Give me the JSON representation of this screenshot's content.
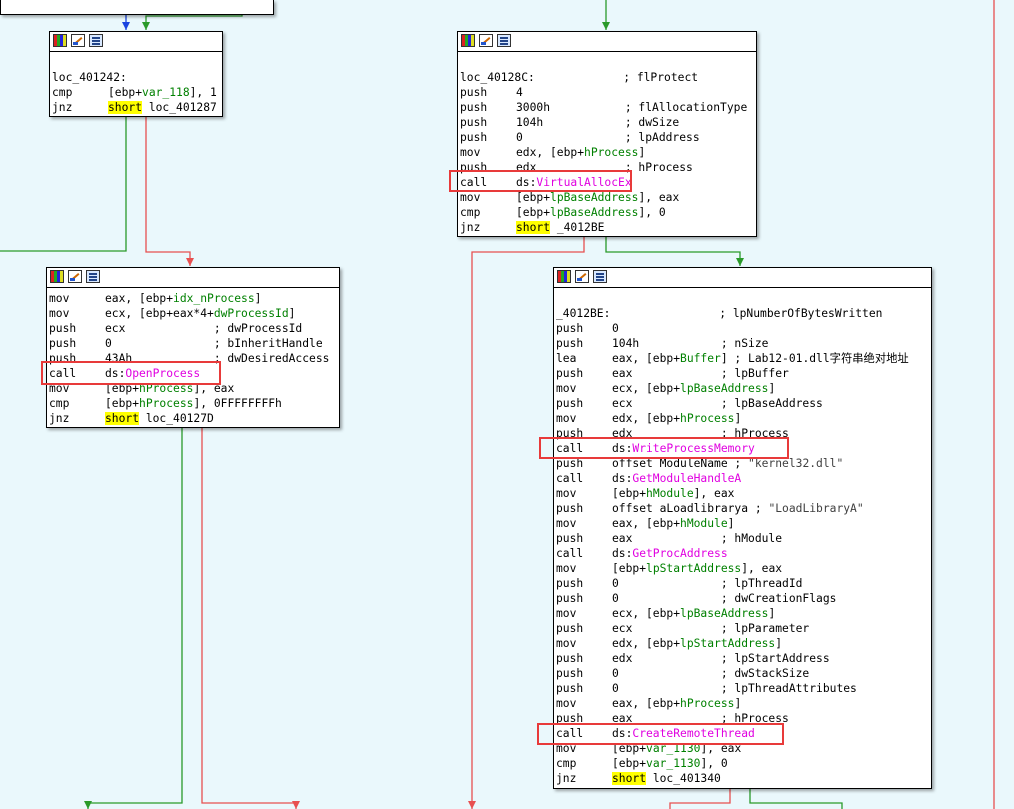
{
  "colors": {
    "bg": "#eaf8fc",
    "green_edge": "#2a9a2a",
    "red_edge": "#e85050",
    "blue_edge": "#1a44e0",
    "func": "#e000e0",
    "var": "#008000",
    "highlight": "#ffff00",
    "callout": "#e83a3a"
  },
  "icons": [
    "palette-icon",
    "edit-graph-icon",
    "listing-icon"
  ],
  "node1": {
    "lines": [
      {
        "label": "",
        "m": "",
        "o": []
      },
      {
        "label": "loc_401242:",
        "m": "",
        "o": []
      },
      {
        "m": "cmp",
        "o": [
          {
            "t": "[ebp+"
          },
          {
            "t": "var_118",
            "c": "v"
          },
          {
            "t": "], 1"
          }
        ]
      },
      {
        "m": "jnz",
        "o": [
          {
            "t": "short",
            "c": "hl"
          },
          {
            "t": " loc_401287"
          }
        ]
      }
    ]
  },
  "node2": {
    "lines": [
      {
        "m": "mov",
        "o": [
          {
            "t": "eax, [ebp+"
          },
          {
            "t": "idx_nProcess",
            "c": "v"
          },
          {
            "t": "]"
          }
        ]
      },
      {
        "m": "mov",
        "o": [
          {
            "t": "ecx, [ebp+eax*4+"
          },
          {
            "t": "dwProcessId",
            "c": "v"
          },
          {
            "t": "]"
          }
        ]
      },
      {
        "m": "push",
        "o": [
          {
            "t": "ecx             ; dwProcessId"
          }
        ]
      },
      {
        "m": "push",
        "o": [
          {
            "t": "0               ; bInheritHandle"
          }
        ]
      },
      {
        "m": "push",
        "o": [
          {
            "t": "43Ah            ; dwDesiredAccess"
          }
        ]
      },
      {
        "m": "call",
        "o": [
          {
            "t": "ds:"
          },
          {
            "t": "OpenProcess",
            "c": "f"
          }
        ]
      },
      {
        "m": "mov",
        "o": [
          {
            "t": "[ebp+"
          },
          {
            "t": "hProcess",
            "c": "v"
          },
          {
            "t": "], eax"
          }
        ]
      },
      {
        "m": "cmp",
        "o": [
          {
            "t": "[ebp+"
          },
          {
            "t": "hProcess",
            "c": "v"
          },
          {
            "t": "], 0FFFFFFFFh"
          }
        ]
      },
      {
        "m": "jnz",
        "o": [
          {
            "t": "short",
            "c": "hl"
          },
          {
            "t": " loc_40127D"
          }
        ]
      }
    ]
  },
  "node3": {
    "lines": [
      {
        "label": "",
        "m": "",
        "o": []
      },
      {
        "label": "loc_40128C:             ; flProtect",
        "m": "",
        "o": []
      },
      {
        "m": "push",
        "o": [
          {
            "t": "4"
          }
        ]
      },
      {
        "m": "push",
        "o": [
          {
            "t": "3000h           ; flAllocationType"
          }
        ]
      },
      {
        "m": "push",
        "o": [
          {
            "t": "104h            ; dwSize"
          }
        ]
      },
      {
        "m": "push",
        "o": [
          {
            "t": "0               ; lpAddress"
          }
        ]
      },
      {
        "m": "mov",
        "o": [
          {
            "t": "edx, [ebp+"
          },
          {
            "t": "hProcess",
            "c": "v"
          },
          {
            "t": "]"
          }
        ]
      },
      {
        "m": "push",
        "o": [
          {
            "t": "edx             ; hProcess"
          }
        ]
      },
      {
        "m": "call",
        "o": [
          {
            "t": "ds:"
          },
          {
            "t": "VirtualAllocEx",
            "c": "f"
          }
        ]
      },
      {
        "m": "mov",
        "o": [
          {
            "t": "[ebp+"
          },
          {
            "t": "lpBaseAddress",
            "c": "v"
          },
          {
            "t": "], eax"
          }
        ]
      },
      {
        "m": "cmp",
        "o": [
          {
            "t": "[ebp+"
          },
          {
            "t": "lpBaseAddress",
            "c": "v"
          },
          {
            "t": "], 0"
          }
        ]
      },
      {
        "m": "jnz",
        "o": [
          {
            "t": "short",
            "c": "hl"
          },
          {
            "t": " _4012BE"
          }
        ]
      }
    ]
  },
  "node4": {
    "lines": [
      {
        "label": "",
        "m": "",
        "o": []
      },
      {
        "label": "_4012BE:                ; lpNumberOfBytesWritten",
        "m": "",
        "o": []
      },
      {
        "m": "push",
        "o": [
          {
            "t": "0"
          }
        ]
      },
      {
        "m": "push",
        "o": [
          {
            "t": "104h            ; nSize"
          }
        ]
      },
      {
        "m": "lea",
        "o": [
          {
            "t": "eax, [ebp+"
          },
          {
            "t": "Buffer",
            "c": "v"
          },
          {
            "t": "] ; Lab12-01.dll字符串绝对地址"
          }
        ]
      },
      {
        "m": "push",
        "o": [
          {
            "t": "eax             ; lpBuffer"
          }
        ]
      },
      {
        "m": "mov",
        "o": [
          {
            "t": "ecx, [ebp+"
          },
          {
            "t": "lpBaseAddress",
            "c": "v"
          },
          {
            "t": "]"
          }
        ]
      },
      {
        "m": "push",
        "o": [
          {
            "t": "ecx             ; lpBaseAddress"
          }
        ]
      },
      {
        "m": "mov",
        "o": [
          {
            "t": "edx, [ebp+"
          },
          {
            "t": "hProcess",
            "c": "v"
          },
          {
            "t": "]"
          }
        ]
      },
      {
        "m": "push",
        "o": [
          {
            "t": "edx             ; hProcess"
          }
        ]
      },
      {
        "m": "call",
        "o": [
          {
            "t": "ds:"
          },
          {
            "t": "WriteProcessMemory",
            "c": "f"
          }
        ]
      },
      {
        "m": "push",
        "o": [
          {
            "t": "offset ModuleName ; "
          },
          {
            "t": "\"kernel32.dll\"",
            "c": "s"
          }
        ]
      },
      {
        "m": "call",
        "o": [
          {
            "t": "ds:"
          },
          {
            "t": "GetModuleHandleA",
            "c": "f"
          }
        ]
      },
      {
        "m": "mov",
        "o": [
          {
            "t": "[ebp+"
          },
          {
            "t": "hModule",
            "c": "v"
          },
          {
            "t": "], eax"
          }
        ]
      },
      {
        "m": "push",
        "o": [
          {
            "t": "offset aLoadlibrarya ; "
          },
          {
            "t": "\"LoadLibraryA\"",
            "c": "s"
          }
        ]
      },
      {
        "m": "mov",
        "o": [
          {
            "t": "eax, [ebp+"
          },
          {
            "t": "hModule",
            "c": "v"
          },
          {
            "t": "]"
          }
        ]
      },
      {
        "m": "push",
        "o": [
          {
            "t": "eax             ; hModule"
          }
        ]
      },
      {
        "m": "call",
        "o": [
          {
            "t": "ds:"
          },
          {
            "t": "GetProcAddress",
            "c": "f"
          }
        ]
      },
      {
        "m": "mov",
        "o": [
          {
            "t": "[ebp+"
          },
          {
            "t": "lpStartAddress",
            "c": "v"
          },
          {
            "t": "], eax"
          }
        ]
      },
      {
        "m": "push",
        "o": [
          {
            "t": "0               ; lpThreadId"
          }
        ]
      },
      {
        "m": "push",
        "o": [
          {
            "t": "0               ; dwCreationFlags"
          }
        ]
      },
      {
        "m": "mov",
        "o": [
          {
            "t": "ecx, [ebp+"
          },
          {
            "t": "lpBaseAddress",
            "c": "v"
          },
          {
            "t": "]"
          }
        ]
      },
      {
        "m": "push",
        "o": [
          {
            "t": "ecx             ; lpParameter"
          }
        ]
      },
      {
        "m": "mov",
        "o": [
          {
            "t": "edx, [ebp+"
          },
          {
            "t": "lpStartAddress",
            "c": "v"
          },
          {
            "t": "]"
          }
        ]
      },
      {
        "m": "push",
        "o": [
          {
            "t": "edx             ; lpStartAddress"
          }
        ]
      },
      {
        "m": "push",
        "o": [
          {
            "t": "0               ; dwStackSize"
          }
        ]
      },
      {
        "m": "push",
        "o": [
          {
            "t": "0               ; lpThreadAttributes"
          }
        ]
      },
      {
        "m": "mov",
        "o": [
          {
            "t": "eax, [ebp+"
          },
          {
            "t": "hProcess",
            "c": "v"
          },
          {
            "t": "]"
          }
        ]
      },
      {
        "m": "push",
        "o": [
          {
            "t": "eax             ; hProcess"
          }
        ]
      },
      {
        "m": "call",
        "o": [
          {
            "t": "ds:"
          },
          {
            "t": "CreateRemoteThread",
            "c": "f"
          }
        ]
      },
      {
        "m": "mov",
        "o": [
          {
            "t": "[ebp+"
          },
          {
            "t": "var_1130",
            "c": "v"
          },
          {
            "t": "], eax"
          }
        ]
      },
      {
        "m": "cmp",
        "o": [
          {
            "t": "[ebp+"
          },
          {
            "t": "var_1130",
            "c": "v"
          },
          {
            "t": "], 0"
          }
        ]
      },
      {
        "m": "jnz",
        "o": [
          {
            "t": "short",
            "c": "hl"
          },
          {
            "t": " loc_401340"
          }
        ]
      }
    ]
  }
}
